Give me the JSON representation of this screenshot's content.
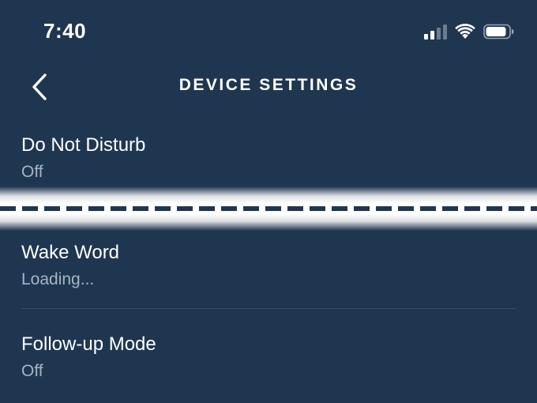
{
  "status_bar": {
    "time": "7:40",
    "icons": [
      "cellular-signal-icon",
      "wifi-icon",
      "battery-icon"
    ]
  },
  "header": {
    "title": "DEVICE SETTINGS",
    "back_icon": "chevron-left-icon"
  },
  "settings": [
    {
      "title": "Do Not Disturb",
      "value": "Off"
    },
    {
      "title": "Wake Word",
      "value": "Loading..."
    },
    {
      "title": "Follow-up Mode",
      "value": "Off"
    }
  ],
  "colors": {
    "background": "#1f3650",
    "primary_text": "#ffffff",
    "secondary_text": "#a7b4c3",
    "cut_band": "#ffffff",
    "dashes": "#1f3650"
  }
}
